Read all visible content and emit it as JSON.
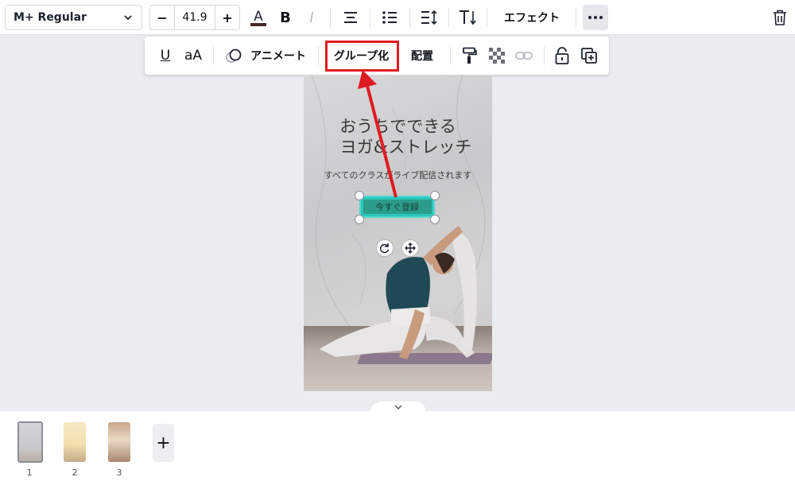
{
  "toolbar": {
    "font_name": "M+ Regular",
    "size_minus": "−",
    "font_size": "41.9",
    "size_plus": "+",
    "bold": "B",
    "italic": "I",
    "effects": "エフェクト"
  },
  "subtoolbar": {
    "underline": "U",
    "case": "aA",
    "animate": "アニメート",
    "group": "グループ化",
    "position": "配置"
  },
  "canvas": {
    "title_line1": "おうちでできる",
    "title_line2": "ヨガ&ストレッチ",
    "subtitle": "すべてのクラスがライブ配信されます",
    "button_label": "今すぐ登録"
  },
  "pages": {
    "numbers": [
      "1",
      "2",
      "3"
    ],
    "add": "+"
  },
  "colors": {
    "highlight": "#e11b22",
    "button_teal": "#29c6bb",
    "text_color_bar": "#4a2a2a"
  }
}
